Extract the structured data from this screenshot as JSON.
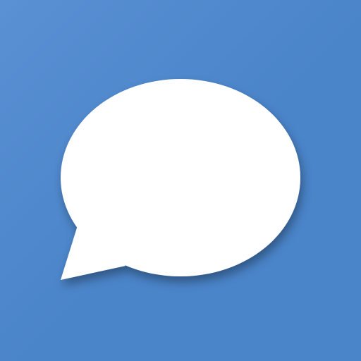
{
  "app_icon": {
    "icon": "chat-bubble-icon",
    "colors": {
      "background": "#4A84C9",
      "background_highlight": "#5A90D4",
      "bubble": "#FFFFFF",
      "shadow": "#1F3E66"
    }
  }
}
